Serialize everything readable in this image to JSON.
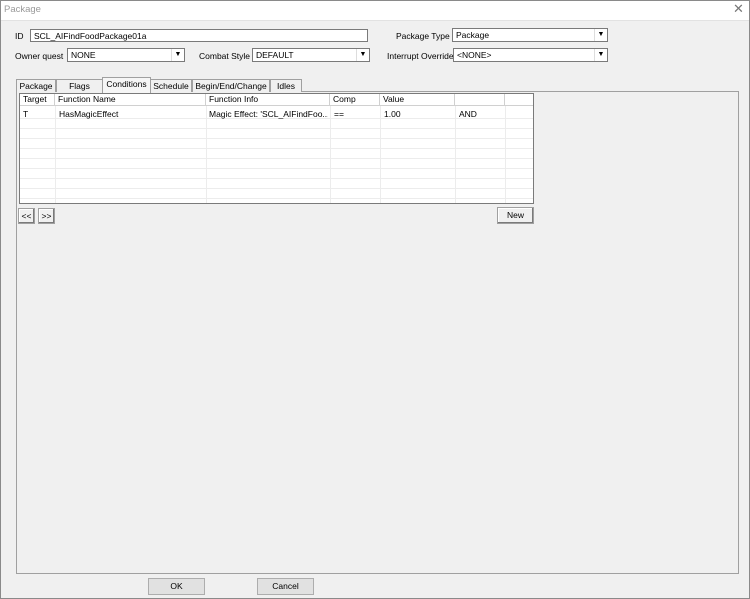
{
  "window": {
    "title": "Package",
    "close_glyph": "✕"
  },
  "form": {
    "id_label": "ID",
    "id_value": "SCL_AIFindFoodPackage01a",
    "package_type_label": "Package Type",
    "package_type_value": "Package",
    "owner_quest_label": "Owner quest",
    "owner_quest_value": "NONE",
    "combat_style_label": "Combat Style",
    "combat_style_value": "DEFAULT",
    "interrupt_override_label": "Interrupt Override",
    "interrupt_override_value": "<NONE>"
  },
  "tabs": [
    {
      "label": "Package"
    },
    {
      "label": "Flags"
    },
    {
      "label": "Conditions",
      "active": true
    },
    {
      "label": "Schedule"
    },
    {
      "label": "Begin/End/Change"
    },
    {
      "label": "Idles"
    }
  ],
  "conditions": {
    "columns": [
      "Target",
      "Function Name",
      "Function Info",
      "Comp",
      "Value",
      "",
      ""
    ],
    "rows": [
      [
        "T",
        "HasMagicEffect",
        "Magic Effect: 'SCL_AIFindFoo...",
        "==",
        "1.00",
        "AND",
        ""
      ]
    ]
  },
  "buttons": {
    "prev": "<<",
    "next": ">>",
    "new": "New",
    "ok": "OK",
    "cancel": "Cancel"
  }
}
